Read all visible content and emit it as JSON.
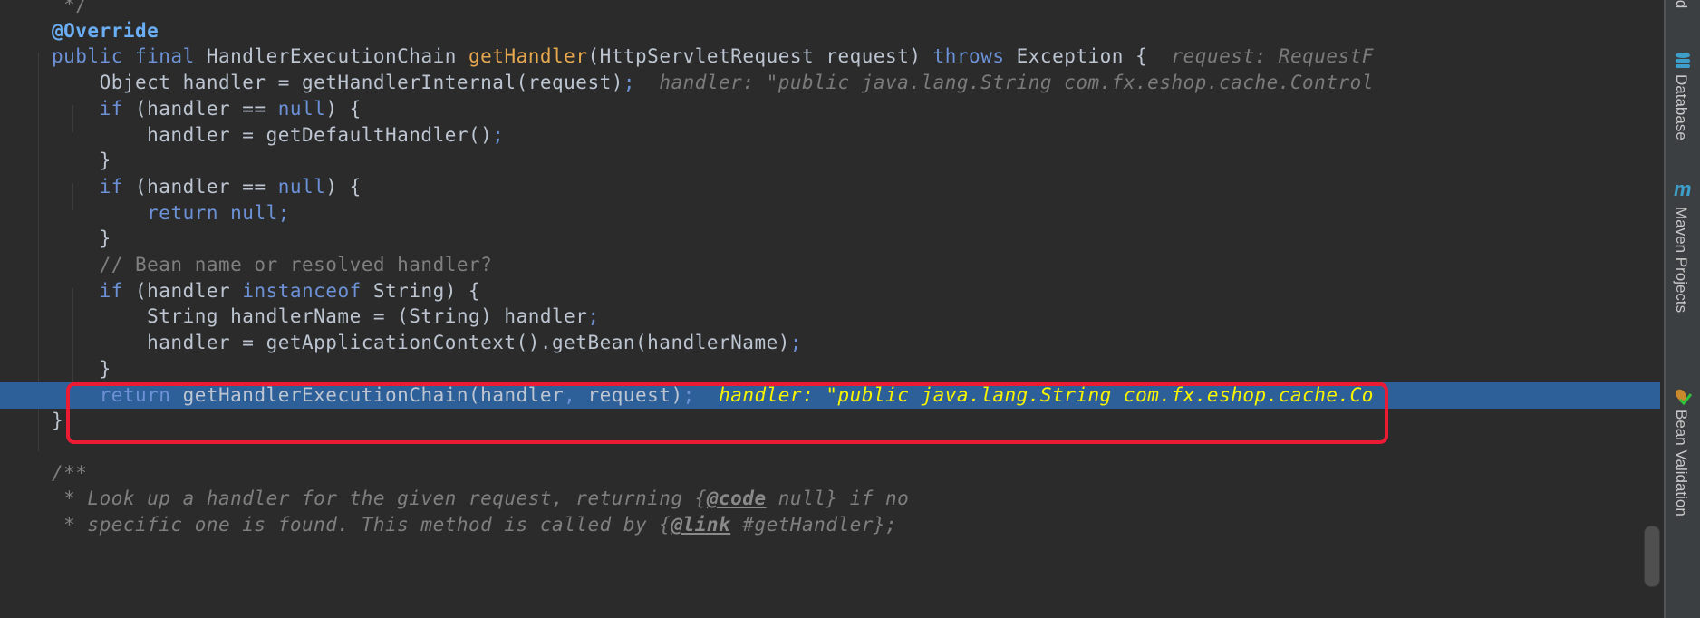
{
  "editor": {
    "lines": [
      [
        {
          "t": " */",
          "c": "cm"
        }
      ],
      [
        {
          "t": "@Override",
          "c": "an"
        }
      ],
      [
        {
          "t": "public final ",
          "c": "kw"
        },
        {
          "t": "HandlerExecutionChain ",
          "c": "pl"
        },
        {
          "t": "getHandler",
          "c": "md"
        },
        {
          "t": "(HttpServletRequest request) ",
          "c": "pl"
        },
        {
          "t": "throws ",
          "c": "kw"
        },
        {
          "t": "Exception {  ",
          "c": "pl"
        },
        {
          "t": "request: RequestF",
          "c": "hint"
        }
      ],
      [
        {
          "t": "    Object handler = getHandlerInternal(request)",
          "c": "pl"
        },
        {
          "t": ";  ",
          "c": "kw"
        },
        {
          "t": "handler: \"public java.lang.String com.fx.eshop.cache.Control",
          "c": "hint"
        }
      ],
      [
        {
          "t": "    ",
          "c": "pl"
        },
        {
          "t": "if ",
          "c": "kw"
        },
        {
          "t": "(handler == ",
          "c": "pl"
        },
        {
          "t": "null",
          "c": "kw"
        },
        {
          "t": ") {",
          "c": "pl"
        }
      ],
      [
        {
          "t": "        handler = getDefaultHandler()",
          "c": "pl"
        },
        {
          "t": ";",
          "c": "kw"
        }
      ],
      [
        {
          "t": "    }",
          "c": "pl"
        }
      ],
      [
        {
          "t": "    ",
          "c": "pl"
        },
        {
          "t": "if ",
          "c": "kw"
        },
        {
          "t": "(handler == ",
          "c": "pl"
        },
        {
          "t": "null",
          "c": "kw"
        },
        {
          "t": ") {",
          "c": "pl"
        }
      ],
      [
        {
          "t": "        ",
          "c": "pl"
        },
        {
          "t": "return null;",
          "c": "kw"
        }
      ],
      [
        {
          "t": "    }",
          "c": "pl"
        }
      ],
      [
        {
          "t": "    // Bean name or resolved handler?",
          "c": "cm"
        }
      ],
      [
        {
          "t": "    ",
          "c": "pl"
        },
        {
          "t": "if ",
          "c": "kw"
        },
        {
          "t": "(handler ",
          "c": "pl"
        },
        {
          "t": "instanceof ",
          "c": "kw"
        },
        {
          "t": "String) {",
          "c": "pl"
        }
      ],
      [
        {
          "t": "        String handlerName = (String) handler",
          "c": "pl"
        },
        {
          "t": ";",
          "c": "kw"
        }
      ],
      [
        {
          "t": "        handler = getApplicationContext().getBean(handlerName)",
          "c": "pl"
        },
        {
          "t": ";",
          "c": "kw"
        }
      ],
      [
        {
          "t": "    }",
          "c": "pl"
        }
      ],
      [
        {
          "t": "    ",
          "c": "pl"
        },
        {
          "t": "return ",
          "c": "kw"
        },
        {
          "t": "getHandlerExecutionChain(handler",
          "c": "pl"
        },
        {
          "t": ", ",
          "c": "kw"
        },
        {
          "t": "request)",
          "c": "pl"
        },
        {
          "t": ";  ",
          "c": "kw"
        },
        {
          "t": "handler: \"public java.lang.String com.fx.eshop.cache.Co",
          "c": "hinty"
        }
      ],
      [
        {
          "t": "}",
          "c": "pl"
        }
      ],
      [],
      [
        {
          "t": "/**",
          "c": "jd"
        }
      ],
      [
        {
          "t": " * Look up a handler for the given request, returning {",
          "c": "jd"
        },
        {
          "t": "@code",
          "c": "jt"
        },
        {
          "t": " null} if no",
          "c": "jd"
        }
      ],
      [
        {
          "t": " * specific one is found. This method is called by {",
          "c": "jd"
        },
        {
          "t": "@link",
          "c": "jt"
        },
        {
          "t": " #getHandler};",
          "c": "jd"
        }
      ]
    ],
    "highlighted_line": 15
  },
  "sidebar": {
    "top_label": "ld",
    "database": "Database",
    "maven_icon": "m",
    "maven": "Maven Projects",
    "bean": "Bean Validation"
  },
  "colors": {
    "highlight": "#2d5f98",
    "annotation_box": "#ea1b33",
    "hint": "#f7f400"
  }
}
